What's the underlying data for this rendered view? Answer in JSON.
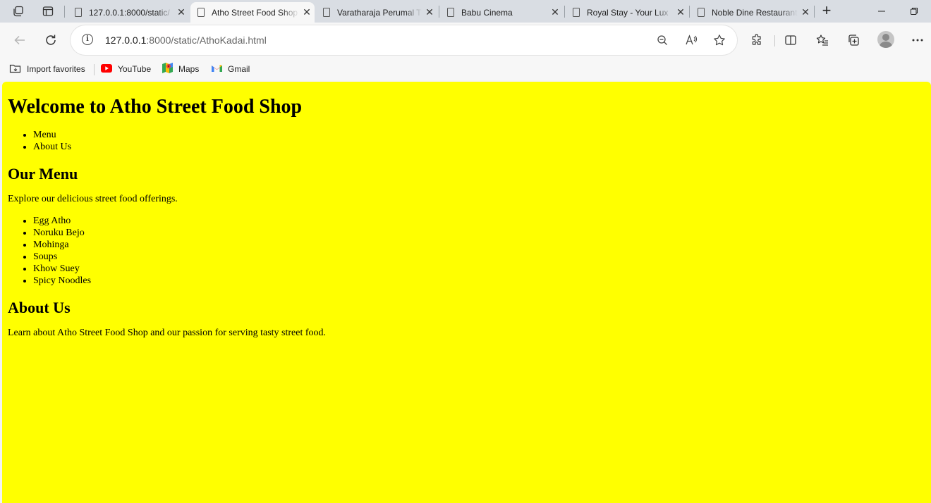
{
  "browser": {
    "tabs": [
      {
        "title": "127.0.0.1:8000/static/",
        "active": false
      },
      {
        "title": "Atho Street Food Shop",
        "active": true
      },
      {
        "title": "Varatharaja Perumal T",
        "active": false
      },
      {
        "title": "Babu Cinema",
        "active": false
      },
      {
        "title": "Royal Stay - Your Lux",
        "active": false
      },
      {
        "title": "Noble Dine Restaurant",
        "active": false
      }
    ],
    "new_tab_label": "+",
    "url_host": "127.0.0.1",
    "url_path": ":8000/static/AthoKadai.html",
    "favorites": [
      {
        "label": "Import favorites",
        "icon": "import-favorites-icon"
      },
      {
        "label": "YouTube",
        "icon": "youtube-icon"
      },
      {
        "label": "Maps",
        "icon": "maps-icon"
      },
      {
        "label": "Gmail",
        "icon": "gmail-icon"
      }
    ]
  },
  "page": {
    "title": "Welcome to Atho Street Food Shop",
    "nav": [
      "Menu",
      "About Us"
    ],
    "menu_section": {
      "heading": "Our Menu",
      "intro": "Explore our delicious street food offerings.",
      "items": [
        "Egg Atho",
        "Noruku Bejo",
        "Mohinga",
        "Soups",
        "Khow Suey",
        "Spicy Noodles"
      ]
    },
    "about_section": {
      "heading": "About Us",
      "text": "Learn about Atho Street Food Shop and our passion for serving tasty street food."
    },
    "background_color": "#ffff00"
  }
}
